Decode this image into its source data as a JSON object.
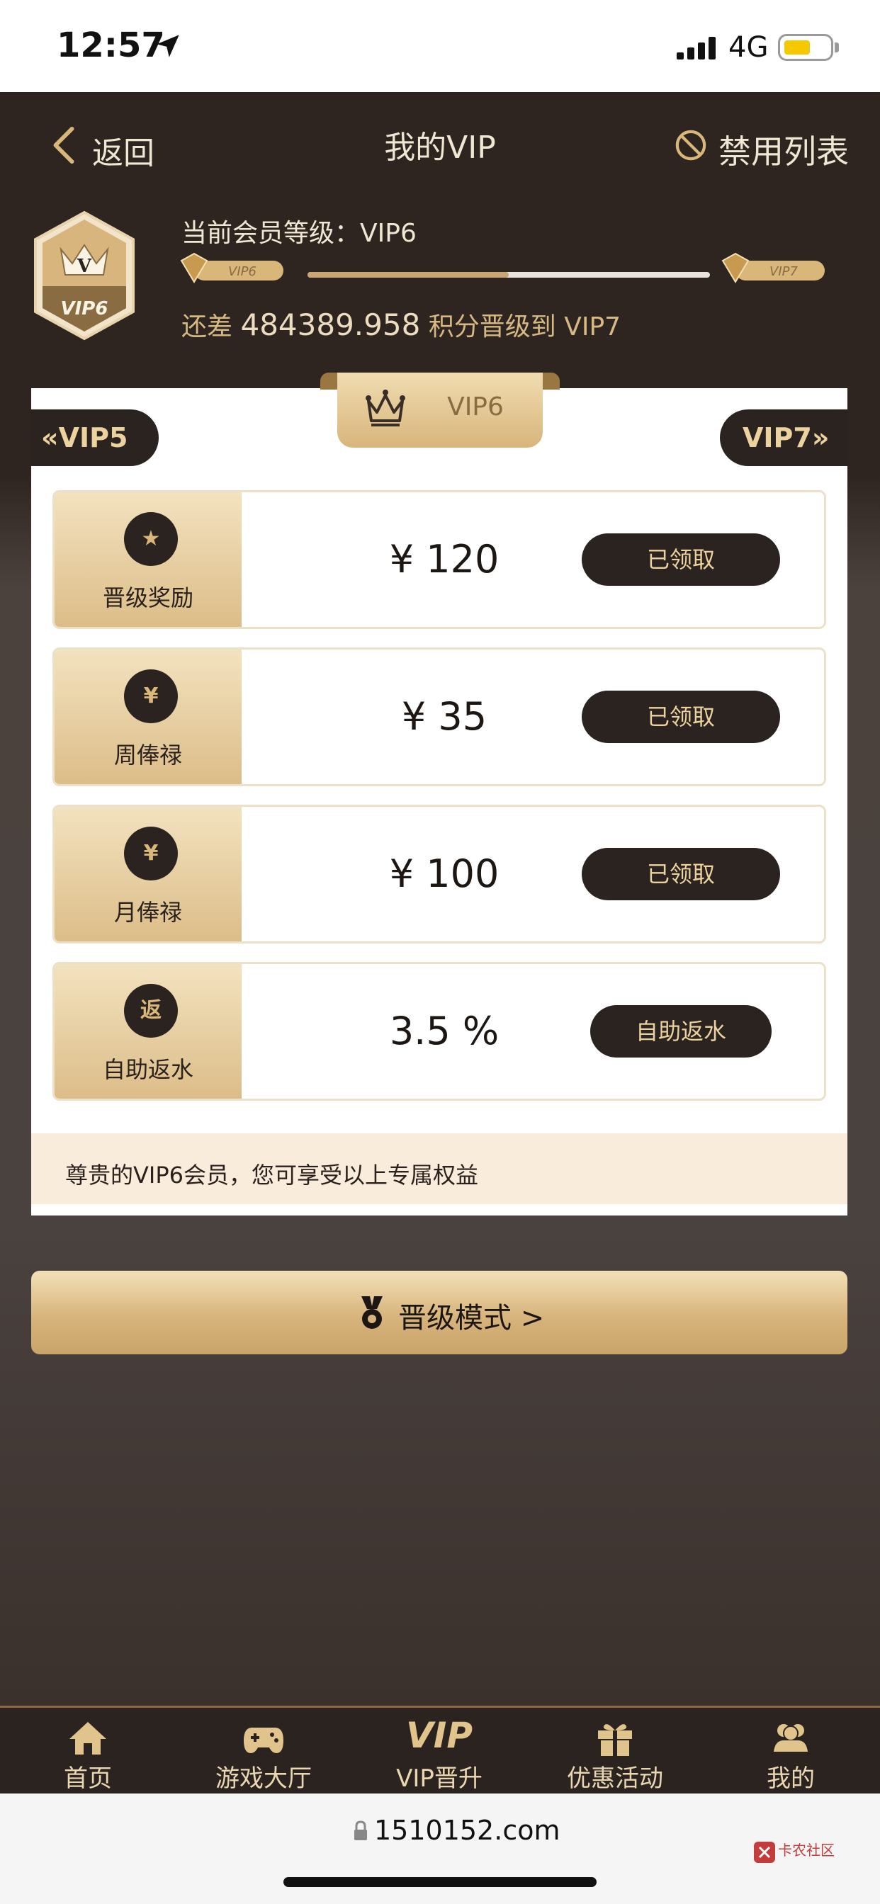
{
  "status_bar": {
    "time": "12:57",
    "network": "4G"
  },
  "nav": {
    "back_label": "返回",
    "title": "我的VIP",
    "ban_list_label": "禁用列表"
  },
  "member": {
    "badge_letter": "V",
    "badge_level": "VIP6",
    "current_level_text": "当前会员等级：VIP6",
    "from_level": "VIP6",
    "to_level": "VIP7",
    "progress": 0.5,
    "remain_prefix": "还差",
    "remain_points": "484389.958",
    "remain_suffix": "积分晋级到 VIP7"
  },
  "level_tabs": {
    "prev": "VIP5",
    "current": "VIP6",
    "next": "VIP7"
  },
  "benefits": [
    {
      "icon": "ribbon-icon",
      "icon_glyph": "★",
      "label": "晋级奖励",
      "value": "¥ 120",
      "button": "已领取"
    },
    {
      "icon": "coins-icon",
      "icon_glyph": "¥",
      "label": "周俸禄",
      "value": "¥ 35",
      "button": "已领取"
    },
    {
      "icon": "money-bag-icon",
      "icon_glyph": "¥",
      "label": "月俸禄",
      "value": "¥ 100",
      "button": "已领取"
    },
    {
      "icon": "rebate-icon",
      "icon_glyph": "返",
      "label": "自助返水",
      "value": "3.5 %",
      "button": "自助返水"
    }
  ],
  "note": "尊贵的VIP6会员，您可享受以上专属权益",
  "upgrade_mode_label": "晋级模式 >",
  "tabbar": {
    "items": [
      {
        "icon": "home-icon",
        "label": "首页"
      },
      {
        "icon": "gamepad-icon",
        "label": "游戏大厅"
      },
      {
        "icon": "vip-icon",
        "icon_text": "VIP",
        "label": "VIP晋升"
      },
      {
        "icon": "gift-icon",
        "label": "优惠活动"
      },
      {
        "icon": "users-icon",
        "label": "我的"
      }
    ]
  },
  "browser": {
    "url": "1510152.com",
    "watermark": "卡农社区"
  },
  "colors": {
    "accent_gold": "#d8b57c",
    "dark_bg": "#2e2521",
    "button_dark": "#2b2320",
    "button_text": "#ecd29e"
  }
}
